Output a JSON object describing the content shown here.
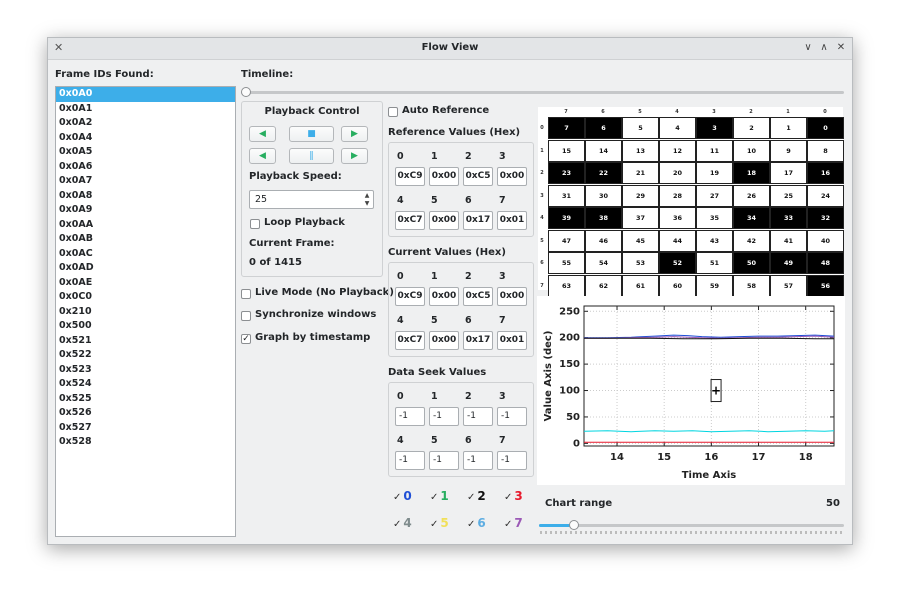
{
  "window": {
    "title": "Flow View",
    "app_icon": "x11-icon",
    "minimize_glyph": "∨",
    "maximize_glyph": "∧",
    "close_glyph": "✕"
  },
  "frame_ids": {
    "label": "Frame IDs Found:",
    "items": [
      "0x0A0",
      "0x0A1",
      "0x0A2",
      "0x0A4",
      "0x0A5",
      "0x0A6",
      "0x0A7",
      "0x0A8",
      "0x0A9",
      "0x0AA",
      "0x0AB",
      "0x0AC",
      "0x0AD",
      "0x0AE",
      "0x0C0",
      "0x210",
      "0x500",
      "0x521",
      "0x522",
      "0x523",
      "0x524",
      "0x525",
      "0x526",
      "0x527",
      "0x528"
    ],
    "selected_index": 0
  },
  "timeline": {
    "label": "Timeline:",
    "position_fraction": 0.0
  },
  "playback": {
    "title": "Playback Control",
    "buttons": [
      {
        "name": "rewind-button",
        "icon": "rewind-icon",
        "glyph": "◀",
        "color": "#27ae60"
      },
      {
        "name": "stop-button",
        "icon": "stop-icon",
        "glyph": "■",
        "color": "#3daee9"
      },
      {
        "name": "play-button",
        "icon": "play-icon",
        "glyph": "▶",
        "color": "#27ae60"
      },
      {
        "name": "step-back-button",
        "icon": "step-back-icon",
        "glyph": "◀",
        "color": "#27ae60"
      },
      {
        "name": "pause-button",
        "icon": "pause-icon",
        "glyph": "‖",
        "color": "#3daee9"
      },
      {
        "name": "step-forward-button",
        "icon": "step-forward-icon",
        "glyph": "▶",
        "color": "#27ae60"
      }
    ],
    "speed_label": "Playback Speed:",
    "speed_value": "25",
    "loop_label": "Loop Playback",
    "loop_checked": false,
    "current_frame_label": "Current Frame:",
    "current_frame_value": "0 of 1415"
  },
  "options": {
    "live_mode": {
      "label": "Live Mode (No Playback)",
      "checked": false
    },
    "sync_windows": {
      "label": "Synchronize windows",
      "checked": false
    },
    "graph_by_timestamp": {
      "label": "Graph by timestamp",
      "checked": true,
      "check_glyph": "✓"
    }
  },
  "auto_reference": {
    "label": "Auto Reference",
    "checked": false
  },
  "reference_values": {
    "title": "Reference Values (Hex)",
    "indices": [
      "0",
      "1",
      "2",
      "3",
      "4",
      "5",
      "6",
      "7"
    ],
    "values": [
      "0xC9",
      "0x00",
      "0xC5",
      "0x00",
      "0xC7",
      "0x00",
      "0x17",
      "0x01"
    ]
  },
  "current_values": {
    "title": "Current Values (Hex)",
    "indices": [
      "0",
      "1",
      "2",
      "3",
      "4",
      "5",
      "6",
      "7"
    ],
    "values": [
      "0xC9",
      "0x00",
      "0xC5",
      "0x00",
      "0xC7",
      "0x00",
      "0x17",
      "0x01"
    ]
  },
  "data_seek": {
    "title": "Data Seek Values",
    "indices": [
      "0",
      "1",
      "2",
      "3",
      "4",
      "5",
      "6",
      "7"
    ],
    "values": [
      "-1",
      "-1",
      "-1",
      "-1",
      "-1",
      "-1",
      "-1",
      "-1"
    ]
  },
  "bit_grid": {
    "col_headers": [
      "7",
      "6",
      "5",
      "4",
      "3",
      "2",
      "1",
      "0"
    ],
    "row_headers": [
      "0",
      "1",
      "2",
      "3",
      "4",
      "5",
      "6",
      "7"
    ],
    "rows": [
      [
        "7",
        "6",
        "5",
        "4",
        "3",
        "2",
        "1",
        "0"
      ],
      [
        "15",
        "14",
        "13",
        "12",
        "11",
        "10",
        "9",
        "8"
      ],
      [
        "23",
        "22",
        "21",
        "20",
        "19",
        "18",
        "17",
        "16"
      ],
      [
        "31",
        "30",
        "29",
        "28",
        "27",
        "26",
        "25",
        "24"
      ],
      [
        "39",
        "38",
        "37",
        "36",
        "35",
        "34",
        "33",
        "32"
      ],
      [
        "47",
        "46",
        "45",
        "44",
        "43",
        "42",
        "41",
        "40"
      ],
      [
        "55",
        "54",
        "53",
        "52",
        "51",
        "50",
        "49",
        "48"
      ],
      [
        "63",
        "62",
        "61",
        "60",
        "59",
        "58",
        "57",
        "56"
      ]
    ],
    "on": [
      [
        1,
        1,
        0,
        0,
        1,
        0,
        0,
        1
      ],
      [
        0,
        0,
        0,
        0,
        0,
        0,
        0,
        0
      ],
      [
        1,
        1,
        0,
        0,
        0,
        1,
        0,
        1
      ],
      [
        0,
        0,
        0,
        0,
        0,
        0,
        0,
        0
      ],
      [
        1,
        1,
        0,
        0,
        0,
        1,
        1,
        1
      ],
      [
        0,
        0,
        0,
        0,
        0,
        0,
        0,
        0
      ],
      [
        0,
        0,
        0,
        1,
        0,
        1,
        1,
        1
      ],
      [
        0,
        0,
        0,
        0,
        0,
        0,
        0,
        1
      ]
    ]
  },
  "graph_checks": [
    {
      "label": "0",
      "checked": true,
      "color": "#1f4fd6"
    },
    {
      "label": "1",
      "checked": true,
      "color": "#27ae60"
    },
    {
      "label": "2",
      "checked": true,
      "color": "#111111"
    },
    {
      "label": "3",
      "checked": true,
      "color": "#e8192c"
    },
    {
      "label": "4",
      "checked": true,
      "color": "#7f8c8d"
    },
    {
      "label": "5",
      "checked": true,
      "color": "#f1e05a"
    },
    {
      "label": "6",
      "checked": true,
      "color": "#5dade2"
    },
    {
      "label": "7",
      "checked": true,
      "color": "#9b59b6"
    }
  ],
  "chart_range": {
    "label": "Chart range",
    "value": "50",
    "position_fraction": 0.1
  },
  "chart_data": {
    "type": "line",
    "xlabel": "Time Axis",
    "ylabel": "Value Axis (dec)",
    "xlim": [
      13.3,
      18.6
    ],
    "ylim": [
      -5,
      260
    ],
    "xticks": [
      14,
      15,
      16,
      17,
      18
    ],
    "yticks": [
      0,
      50,
      100,
      150,
      200,
      250
    ],
    "grid": true,
    "cursor": {
      "x": 16.1,
      "y": 100,
      "glyph": "+"
    },
    "series": [
      {
        "color": "#1f4fd6",
        "x": [
          13.3,
          13.8,
          14.3,
          14.8,
          15.2,
          15.5,
          15.8,
          16.2,
          16.6,
          17.0,
          17.4,
          17.8,
          18.2,
          18.6
        ],
        "values": [
          200,
          200,
          201,
          203,
          205,
          204,
          202,
          201,
          202,
          203,
          203,
          204,
          205,
          203
        ]
      },
      {
        "color": "#9b59b6",
        "x": [
          13.3,
          13.8,
          14.3,
          14.8,
          15.2,
          15.5,
          15.8,
          16.2,
          16.6,
          17.0,
          17.4,
          17.8,
          18.2,
          18.6
        ],
        "values": [
          199,
          199,
          200,
          201,
          202,
          201,
          200,
          199,
          200,
          201,
          201,
          202,
          203,
          201
        ]
      },
      {
        "color": "#111111",
        "x": [
          13.3,
          14.0,
          14.7,
          15.4,
          16.1,
          16.8,
          17.5,
          18.2,
          18.6
        ],
        "values": [
          199,
          199,
          199,
          198,
          198,
          199,
          199,
          198,
          198
        ]
      },
      {
        "color": "#00d5e0",
        "x": [
          13.3,
          13.8,
          14.3,
          14.8,
          15.2,
          15.6,
          16.0,
          16.4,
          16.8,
          17.2,
          17.6,
          18.0,
          18.4,
          18.6
        ],
        "values": [
          23,
          24,
          22,
          24,
          23,
          24,
          22,
          23,
          24,
          22,
          23,
          24,
          23,
          24
        ]
      },
      {
        "color": "#e8192c",
        "x": [
          13.3,
          18.6
        ],
        "values": [
          2,
          2
        ]
      }
    ]
  }
}
